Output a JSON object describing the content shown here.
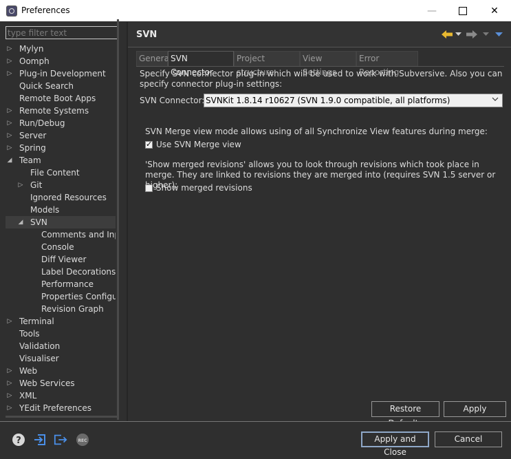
{
  "window": {
    "title": "Preferences",
    "minimize": "—",
    "close": "✕"
  },
  "filter": {
    "placeholder": "type filter text"
  },
  "tree": [
    {
      "label": "Mylyn",
      "toggle": "▷",
      "level": 0
    },
    {
      "label": "Oomph",
      "toggle": "▷",
      "level": 0
    },
    {
      "label": "Plug-in Development",
      "toggle": "▷",
      "level": 0
    },
    {
      "label": "Quick Search",
      "toggle": "",
      "level": 0
    },
    {
      "label": "Remote Boot Apps",
      "toggle": "",
      "level": 0
    },
    {
      "label": "Remote Systems",
      "toggle": "▷",
      "level": 0
    },
    {
      "label": "Run/Debug",
      "toggle": "▷",
      "level": 0
    },
    {
      "label": "Server",
      "toggle": "▷",
      "level": 0
    },
    {
      "label": "Spring",
      "toggle": "▷",
      "level": 0
    },
    {
      "label": "Team",
      "toggle": "◢",
      "level": 0
    },
    {
      "label": "File Content",
      "toggle": "",
      "level": 1
    },
    {
      "label": "Git",
      "toggle": "▷",
      "level": 1
    },
    {
      "label": "Ignored Resources",
      "toggle": "",
      "level": 1
    },
    {
      "label": "Models",
      "toggle": "",
      "level": 1
    },
    {
      "label": "SVN",
      "toggle": "◢",
      "level": 1,
      "selected": true
    },
    {
      "label": "Comments and Inpu",
      "toggle": "",
      "level": 2
    },
    {
      "label": "Console",
      "toggle": "",
      "level": 2
    },
    {
      "label": "Diff Viewer",
      "toggle": "",
      "level": 2
    },
    {
      "label": "Label Decorations",
      "toggle": "",
      "level": 2
    },
    {
      "label": "Performance",
      "toggle": "",
      "level": 2
    },
    {
      "label": "Properties Configura",
      "toggle": "",
      "level": 2
    },
    {
      "label": "Revision Graph",
      "toggle": "",
      "level": 2
    },
    {
      "label": "Terminal",
      "toggle": "▷",
      "level": 0
    },
    {
      "label": "Tools",
      "toggle": "",
      "level": 0
    },
    {
      "label": "Validation",
      "toggle": "",
      "level": 0
    },
    {
      "label": "Visualiser",
      "toggle": "",
      "level": 0
    },
    {
      "label": "Web",
      "toggle": "▷",
      "level": 0
    },
    {
      "label": "Web Services",
      "toggle": "▷",
      "level": 0
    },
    {
      "label": "XML",
      "toggle": "▷",
      "level": 0
    },
    {
      "label": "YEdit Preferences",
      "toggle": "▷",
      "level": 0
    }
  ],
  "page": {
    "title": "SVN",
    "tabs": [
      {
        "label": "General",
        "active": false
      },
      {
        "label": "SVN Connector",
        "active": true
      },
      {
        "label": "Project structure",
        "active": false
      },
      {
        "label": "View Settings",
        "active": false
      },
      {
        "label": "Error Reporting",
        "active": false
      }
    ],
    "description": "Specify SVN connector plug-in which will be used to work with Subversive. Also you can specify connector plug-in settings:",
    "connector_label": "SVN Connector:",
    "connector_value": "SVNKit 1.8.14 r10627 (SVN 1.9.0 compatible, all platforms)",
    "merge_description": "SVN Merge view mode allows using of all Synchronize View features during merge:",
    "use_merge_view": {
      "label": "Use SVN Merge view",
      "checked": true,
      "mark": "✓"
    },
    "revisions_description": "'Show merged revisions' allows you to look through revisions which took place in merge. They are linked to revisions they are merged into (requires SVN 1.5 server or higher):",
    "show_merged_revisions": {
      "label": "Show merged revisions",
      "checked": false
    }
  },
  "buttons": {
    "restore_defaults": "Restore Defaults",
    "apply": "Apply",
    "apply_and_close": "Apply and Close",
    "cancel": "Cancel"
  },
  "footer": {
    "rec_label": "REC"
  },
  "colors": {
    "back_arrow": "#e8b830",
    "forward_arrow": "#8a8a8a",
    "menu_arrow": "#5a8fd8",
    "footer_blue": "#4a8fe8"
  }
}
